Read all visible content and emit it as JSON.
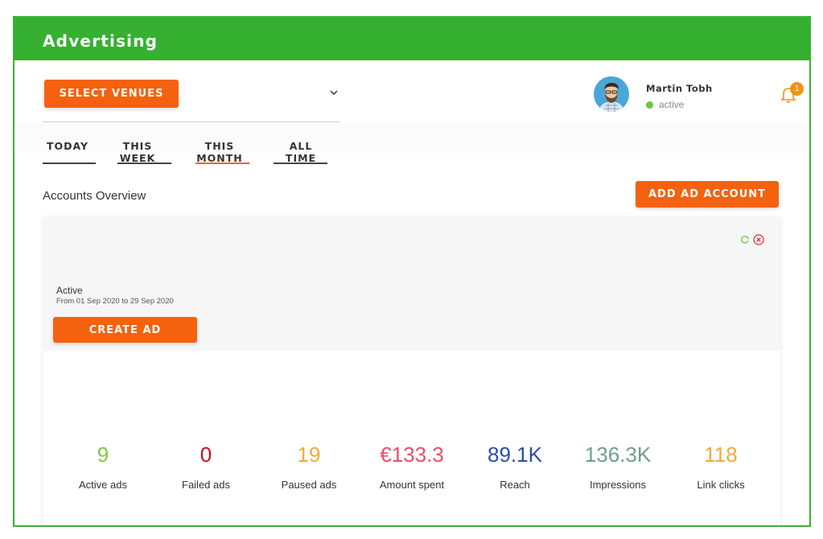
{
  "app": {
    "title": "Advertising"
  },
  "topbar": {
    "venue_button": "SELECT VENUES",
    "user": {
      "name": "Martin Tobh",
      "status": "active"
    },
    "notifications": {
      "count": "1"
    }
  },
  "tabs": [
    {
      "label": "TODAY",
      "active": false
    },
    {
      "label": "THIS WEEK",
      "active": false
    },
    {
      "label": "THIS MONTH",
      "active": true
    },
    {
      "label": "ALL TIME",
      "active": false
    }
  ],
  "section": {
    "title": "Accounts Overview",
    "add_button": "ADD AD ACCOUNT"
  },
  "account_card": {
    "status": "Active",
    "date_range": "From 01 Sep 2020 to 29 Sep 2020",
    "create_button": "CREATE AD"
  },
  "stats": [
    {
      "value": "9",
      "label": "Active ads",
      "color": "#7ac943"
    },
    {
      "value": "0",
      "label": "Failed ads",
      "color": "#c1121f"
    },
    {
      "value": "19",
      "label": "Paused ads",
      "color": "#f4a83a"
    },
    {
      "value": "€133.3",
      "label": "Amount spent",
      "color": "#ea4c6e"
    },
    {
      "value": "89.1K",
      "label": "Reach",
      "color": "#2c4ea8"
    },
    {
      "value": "136.3K",
      "label": "Impressions",
      "color": "#6e9f8e"
    },
    {
      "value": "118",
      "label": "Link clicks",
      "color": "#f4a83a"
    }
  ],
  "colors": {
    "brand_green": "#36b031",
    "accent_orange": "#f4620f",
    "status_active": "#6ac43d"
  }
}
